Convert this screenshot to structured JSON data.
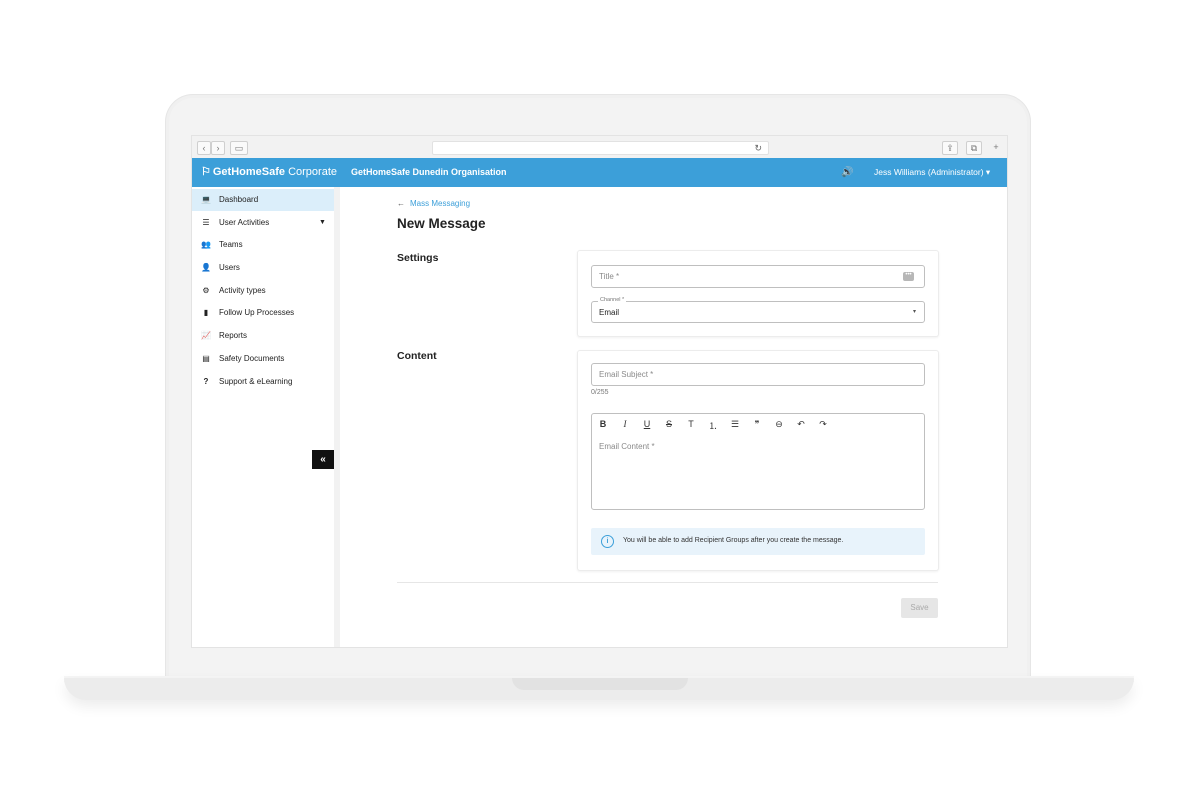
{
  "browser": {
    "nav_back": "‹",
    "nav_forward": "›",
    "sidebar_toggle": "▭",
    "reload": "↻",
    "share": "⇪",
    "tabs": "⧉",
    "new_tab": "+"
  },
  "header": {
    "brand_icon": "⚐",
    "brand_name": "GetHomeSafe",
    "brand_suffix": "Corporate",
    "org_name": "GetHomeSafe Dunedin Organisation",
    "speaker_icon": "🔊",
    "user_label": "Jess Williams (Administrator) ▾",
    "color": "#3c9fd9"
  },
  "sidebar": {
    "items": [
      {
        "icon": "💻",
        "label": "Dashboard"
      },
      {
        "icon": "☰",
        "label": "User Activities"
      },
      {
        "icon": "👥",
        "label": "Teams"
      },
      {
        "icon": "👤",
        "label": "Users"
      },
      {
        "icon": "⚙",
        "label": "Activity types"
      },
      {
        "icon": "▮",
        "label": "Follow Up Processes"
      },
      {
        "icon": "📈",
        "label": "Reports"
      },
      {
        "icon": "▤",
        "label": "Safety Documents"
      },
      {
        "icon": "?",
        "label": "Support & eLearning"
      }
    ],
    "active_index": 0,
    "expand_caret": "▼",
    "collapse_label": "«"
  },
  "main": {
    "back_arrow": "←",
    "back_label": "Mass Messaging",
    "title": "New Message",
    "settings": {
      "section_label": "Settings",
      "title_placeholder": "Title *",
      "dots": "•••",
      "channel_legend": "Channel *",
      "channel_value": "Email",
      "channel_caret": "▾"
    },
    "content": {
      "section_label": "Content",
      "subject_placeholder": "Email Subject *",
      "subject_counter": "0/255",
      "toolbar": {
        "bold": "B",
        "italic": "I",
        "underline": "U",
        "strike": "S",
        "heading": "T",
        "ordered_list": "⒈",
        "bullet_list": "☰",
        "quote": "❞",
        "link": "⊖",
        "undo": "↶",
        "redo": "↷"
      },
      "content_placeholder": "Email Content *",
      "info_icon": "i",
      "info_text": "You will be able to add Recipient Groups after you create the message."
    },
    "save_label": "Save"
  }
}
